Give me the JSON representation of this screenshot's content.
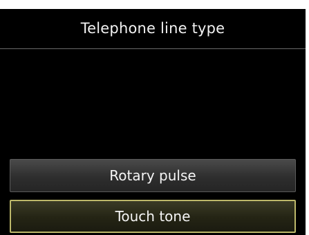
{
  "screen": {
    "title": "Telephone line type"
  },
  "options": [
    {
      "label": "Rotary pulse",
      "selected": false
    },
    {
      "label": "Touch tone",
      "selected": true
    }
  ],
  "colors": {
    "background": "#000000",
    "text": "#f2f2f2",
    "selected_border": "#bdb86a"
  }
}
